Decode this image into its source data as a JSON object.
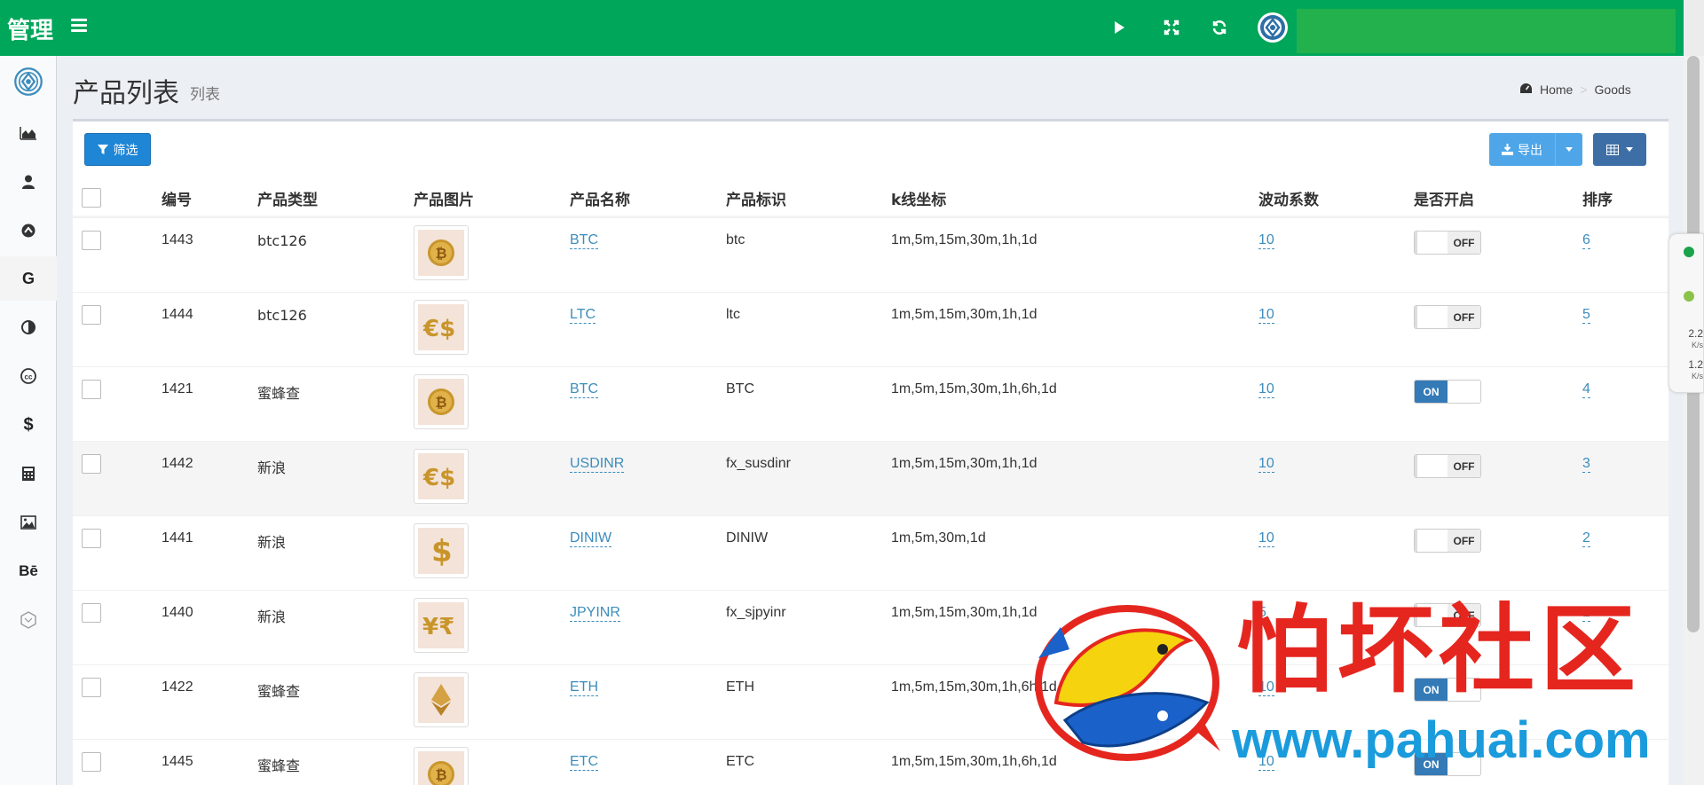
{
  "header": {
    "brand": "管理",
    "icons": [
      "play-icon",
      "expand-icon",
      "refresh-icon",
      "avatar"
    ]
  },
  "sidebar": {
    "items": [
      {
        "icon": "logo-icon"
      },
      {
        "icon": "area-chart-icon"
      },
      {
        "icon": "user-icon"
      },
      {
        "icon": "arrow-up-circle-icon"
      },
      {
        "icon": "google-icon"
      },
      {
        "icon": "adjust-icon"
      },
      {
        "icon": "cc-icon"
      },
      {
        "icon": "dollar-icon"
      },
      {
        "icon": "calculator-icon"
      },
      {
        "icon": "image-icon"
      },
      {
        "icon": "behance-icon"
      },
      {
        "icon": "hexagon-icon"
      }
    ]
  },
  "page": {
    "title": "产品列表",
    "subtitle": "列表",
    "breadcrumb": [
      "Home",
      "Goods"
    ]
  },
  "toolbar": {
    "filter_label": "筛选",
    "export_label": "导出"
  },
  "table": {
    "columns": [
      "编号",
      "产品类型",
      "产品图片",
      "产品名称",
      "产品标识",
      "k线坐标",
      "波动系数",
      "是否开启",
      "排序"
    ],
    "rows": [
      {
        "id": "1443",
        "type": "btc126",
        "image": "bitcoin",
        "name": "BTC",
        "code": "btc",
        "kline": "1m,5m,15m,30m,1h,1d",
        "coef": "10",
        "enabled": "OFF",
        "sort": "6"
      },
      {
        "id": "1444",
        "type": "btc126",
        "image": "euro-dollar",
        "name": "LTC",
        "code": "ltc",
        "kline": "1m,5m,15m,30m,1h,1d",
        "coef": "10",
        "enabled": "OFF",
        "sort": "5"
      },
      {
        "id": "1421",
        "type": "蜜蜂查",
        "image": "bitcoin",
        "name": "BTC",
        "code": "BTC",
        "kline": "1m,5m,15m,30m,1h,6h,1d",
        "coef": "10",
        "enabled": "ON",
        "sort": "4"
      },
      {
        "id": "1442",
        "type": "新浪",
        "image": "euro-dollar",
        "name": "USDINR",
        "code": "fx_susdinr",
        "kline": "1m,5m,15m,30m,1h,1d",
        "coef": "10",
        "enabled": "OFF",
        "sort": "3"
      },
      {
        "id": "1441",
        "type": "新浪",
        "image": "dollar",
        "name": "DINIW",
        "code": "DINIW",
        "kline": "1m,5m,30m,1d",
        "coef": "10",
        "enabled": "OFF",
        "sort": "2"
      },
      {
        "id": "1440",
        "type": "新浪",
        "image": "yen-rupee",
        "name": "JPYINR",
        "code": "fx_sjpyinr",
        "kline": "1m,5m,15m,30m,1h,1d",
        "coef": "5",
        "enabled": "OFF",
        "sort": "1"
      },
      {
        "id": "1422",
        "type": "蜜蜂查",
        "image": "ethereum",
        "name": "ETH",
        "code": "ETH",
        "kline": "1m,5m,15m,30m,1h,6h,1d",
        "coef": "10",
        "enabled": "ON",
        "sort": ""
      },
      {
        "id": "1445",
        "type": "蜜蜂查",
        "image": "bitcoin",
        "name": "ETC",
        "code": "ETC",
        "kline": "1m,5m,15m,30m,1h,6h,1d",
        "coef": "10",
        "enabled": "ON",
        "sort": ""
      }
    ]
  },
  "net_widget": {
    "up": "2.2",
    "down": "1.2",
    "unit": "K/s"
  },
  "watermark": {
    "title": "怕坏社区",
    "url": "www.pahuai.com"
  },
  "colors": {
    "header": "#00a65a",
    "primary": "#1f86d6",
    "link": "#3c8dbc",
    "toggle_on": "#337ab7",
    "watermark_red": "#e5261f",
    "watermark_blue": "#1a9bdc"
  }
}
